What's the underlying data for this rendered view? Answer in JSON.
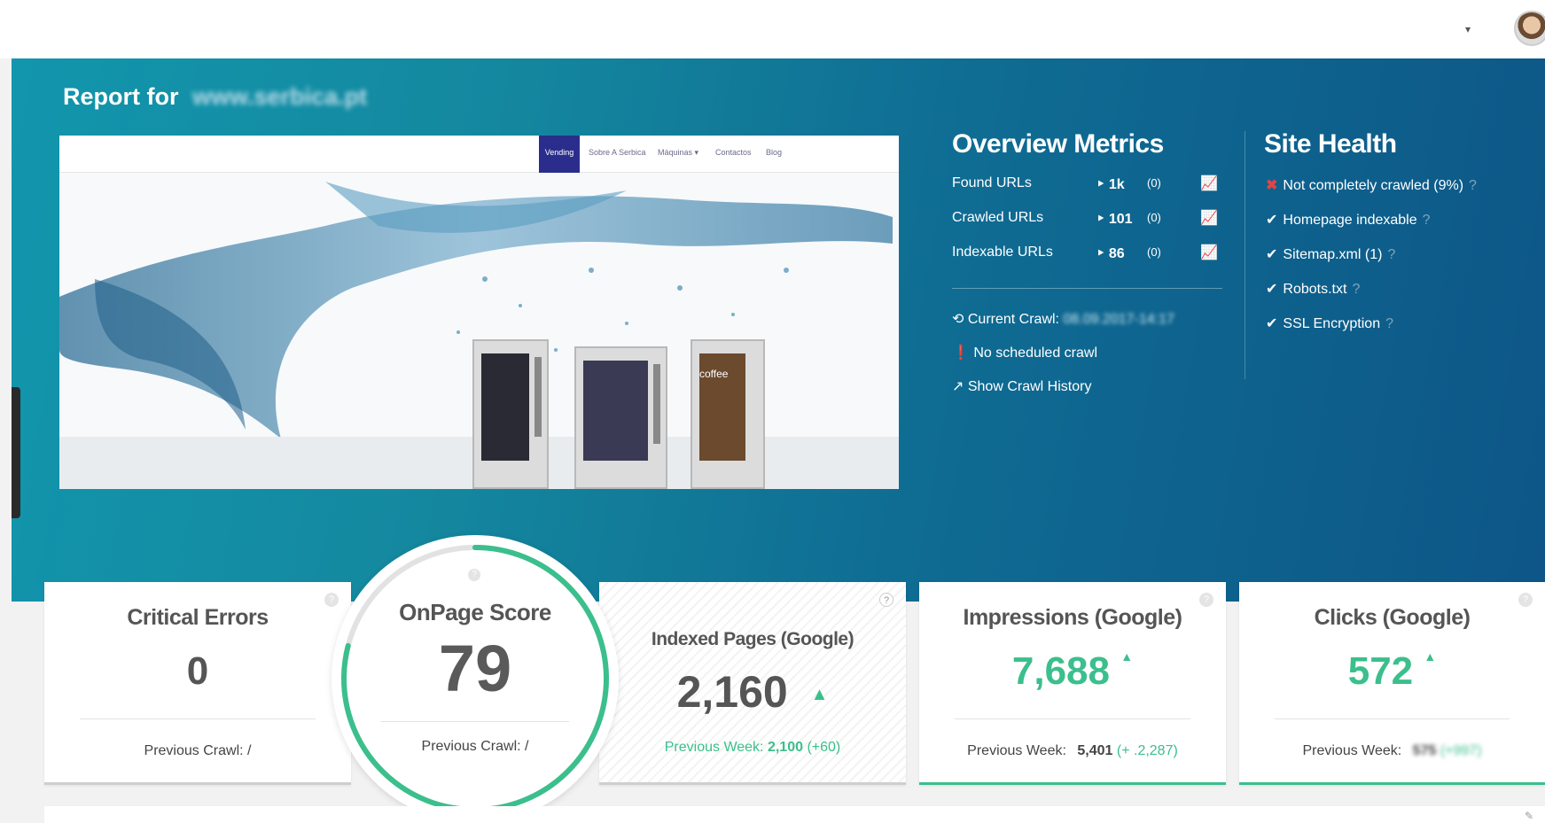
{
  "header": {
    "caret": "▾",
    "avatar_icon": "avatar"
  },
  "report": {
    "title": "Report for",
    "domain": "www.serbica.pt"
  },
  "preview": {
    "nav": [
      "Vending",
      "Sobre A Serbica",
      "Máquinas ▾",
      "Contactos",
      "Blog"
    ],
    "coffee_label": "coffee"
  },
  "overview": {
    "title": "Overview Metrics",
    "rows": [
      {
        "label": "Found URLs",
        "value": "‣ 1k",
        "delta": "(0)",
        "trend_icon": "chart-line-icon"
      },
      {
        "label": "Crawled URLs",
        "value": "‣ 101",
        "delta": "(0)",
        "trend_icon": "chart-line-icon"
      },
      {
        "label": "Indexable URLs",
        "value": "‣ 86",
        "delta": "(0)",
        "trend_icon": "chart-line-icon"
      }
    ],
    "current_crawl_label": "Current Crawl:",
    "current_crawl_value": "08.09.2017-14:17",
    "no_schedule": "No scheduled crawl",
    "history": "Show Crawl History"
  },
  "health": {
    "title": "Site Health",
    "items": [
      {
        "status": "fail",
        "label": "Not completely crawled (9%)",
        "help": "?"
      },
      {
        "status": "ok",
        "label": "Homepage indexable",
        "help": "?"
      },
      {
        "status": "ok",
        "label": "Sitemap.xml (1)",
        "help": "?"
      },
      {
        "status": "ok",
        "label": "Robots.txt",
        "help": "?"
      },
      {
        "status": "ok",
        "label": "SSL Encryption",
        "help": "?"
      }
    ]
  },
  "cards": {
    "critical": {
      "title": "Critical Errors",
      "value": "0",
      "foot": "Previous Crawl: /"
    },
    "score": {
      "title": "OnPage Score",
      "value": "79",
      "foot": "Previous Crawl: /",
      "score_fraction": 0.79
    },
    "indexed": {
      "title": "Indexed Pages (Google)",
      "value": "2,160",
      "arrow": "▲",
      "foot_label": "Previous Week:",
      "foot_value": "2,100",
      "foot_delta": "(+60)"
    },
    "impressions": {
      "title": "Impressions (Google)",
      "value": "7,688",
      "arrow": "▲",
      "foot_label": "Previous Week:",
      "foot_value": "5,401",
      "foot_delta": "(+ .2,287)"
    },
    "clicks": {
      "title": "Clicks (Google)",
      "value": "572",
      "arrow": "▲",
      "foot_label": "Previous Week:",
      "foot_value": "575",
      "foot_delta": "(+997)"
    }
  },
  "colors": {
    "accent_green": "#3bbf8c",
    "hero_start": "#1296ad",
    "hero_end": "#0d5687",
    "fail_red": "#e04545"
  }
}
